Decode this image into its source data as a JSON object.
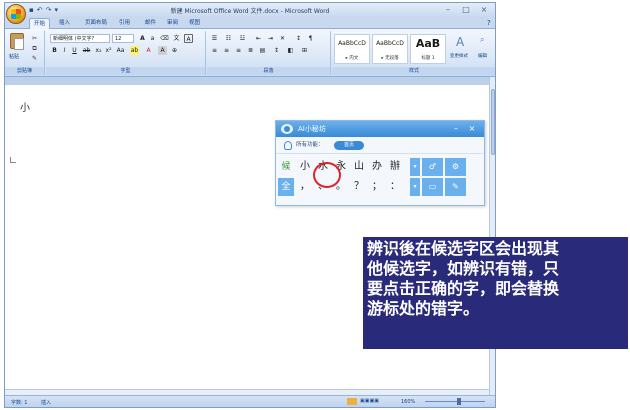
{
  "window": {
    "title": "新建 Microsoft Office Word 文件.docx - Microsoft Word",
    "minimize": "–",
    "maximize": "□",
    "close": "×"
  },
  "ribbon_tabs": [
    "开始",
    "插入",
    "页面布局",
    "引用",
    "邮件",
    "审阅",
    "视图"
  ],
  "ribbon": {
    "paste_label": "粘贴",
    "font_name": "新细明体 (中文字?",
    "font_size": "12",
    "style_samples": [
      {
        "sample": "AaBbCcD",
        "name": "▸ 内文"
      },
      {
        "sample": "AaBbCcD",
        "name": "▸ 无段落"
      },
      {
        "sample": "AaB",
        "name": "标题 1"
      }
    ],
    "change_styles": "变更样式",
    "edit": "编辑",
    "groups": [
      "剪贴簿",
      "字型",
      "段落",
      "样式"
    ]
  },
  "document": {
    "text": "小"
  },
  "ime": {
    "title": "AI小秘坊",
    "func_label": "所有功能：",
    "func_pill": "首页",
    "row1_tag": "候",
    "row1": [
      "小",
      "水",
      "永",
      "山",
      "办",
      "辦"
    ],
    "row2_tag": "全",
    "row2": [
      "，",
      "、",
      "。",
      "？",
      "；",
      "："
    ]
  },
  "status": {
    "page": "字数: 1",
    "mode": "插入",
    "zoom": "160%"
  },
  "note": {
    "lines": [
      "辨识後在候选字区会出现其",
      "他候选字，如辨识有错，只",
      "要点击正确的字，即会替换",
      "游标处的错字。"
    ]
  },
  "colors": {
    "note_bg": "#2a2a7a",
    "ime_title": "#3a8ad6",
    "highlight_circle": "#e0202a"
  }
}
